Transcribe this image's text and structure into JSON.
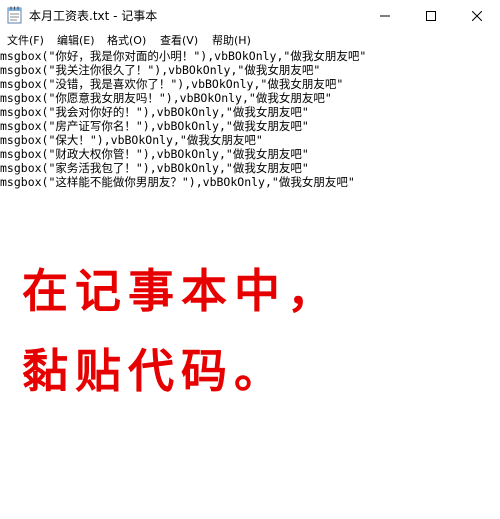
{
  "window": {
    "title": "本月工资表.txt - 记事本"
  },
  "menu": {
    "file": "文件(F)",
    "edit": "编辑(E)",
    "format": "格式(O)",
    "view": "查看(V)",
    "help": "帮助(H)"
  },
  "editor": {
    "lines": [
      "msgbox(\"你好，我是你对面的小明！\"),vbBOkOnly,\"做我女朋友吧\"",
      "msgbox(\"我关注你很久了！\"),vbBOkOnly,\"做我女朋友吧\"",
      "msgbox(\"没错，我是喜欢你了！\"),vbBOkOnly,\"做我女朋友吧\"",
      "msgbox(\"你愿意我女朋友吗！\"),vbBOkOnly,\"做我女朋友吧\"",
      "msgbox(\"我会对你好的！\"),vbBOkOnly,\"做我女朋友吧\"",
      "msgbox(\"房产证写你名！\"),vbBOkOnly,\"做我女朋友吧\"",
      "msgbox(\"保大！\"),vbBOkOnly,\"做我女朋友吧\"",
      "msgbox(\"财政大权你管！\"),vbBOkOnly,\"做我女朋友吧\"",
      "msgbox(\"家务活我包了！\"),vbBOkOnly,\"做我女朋友吧\"",
      "msgbox(\"这样能不能做你男朋友？\"),vbBOkOnly,\"做我女朋友吧\""
    ]
  },
  "caption": {
    "line1": "在记事本中，",
    "line2": "黏贴代码。"
  },
  "icons": {
    "app": "notepad-icon",
    "minimize": "minimize-icon",
    "maximize": "maximize-icon",
    "close": "close-icon"
  },
  "colors": {
    "caption": "#e60000",
    "text": "#000000",
    "background": "#ffffff"
  }
}
